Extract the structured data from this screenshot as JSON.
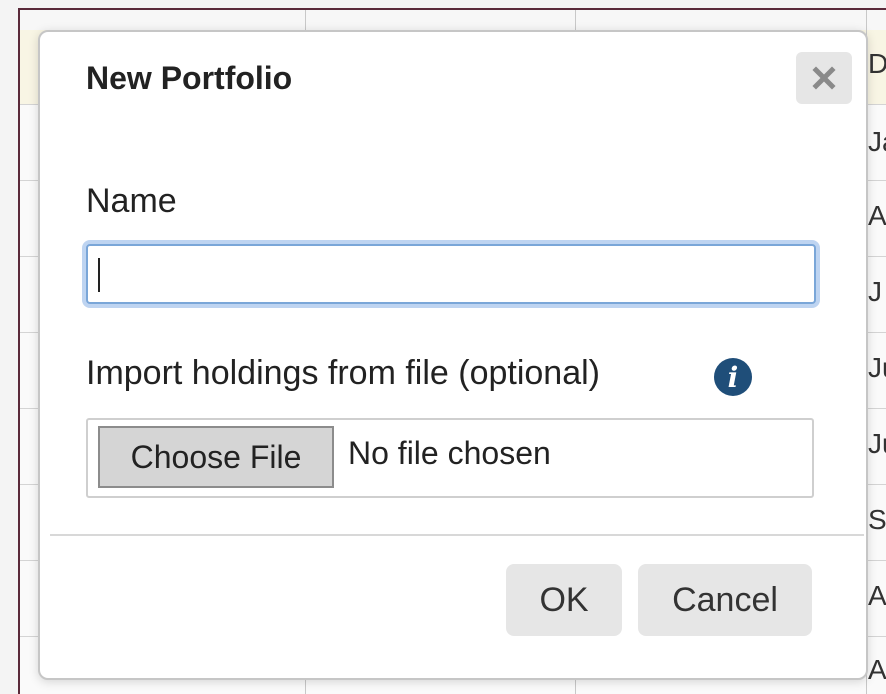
{
  "background_table": {
    "edge_texts": [
      "D",
      "Ja",
      "A",
      "J",
      "Ju",
      "Ju",
      "S",
      "A",
      "A"
    ]
  },
  "dialog": {
    "title": "New Portfolio",
    "close_icon": "close-x-icon",
    "name_label": "Name",
    "name_value": "",
    "import_label": "Import holdings from file (optional)",
    "info_icon": "info-icon",
    "info_glyph": "i",
    "choose_file_label": "Choose File",
    "file_status": "No file chosen",
    "ok_label": "OK",
    "cancel_label": "Cancel"
  },
  "colors": {
    "input_focus": "#7aa6d8",
    "info_icon_bg": "#1f4e79",
    "button_bg": "#e6e6e6",
    "bg_frame_border": "#5a2a3a"
  }
}
